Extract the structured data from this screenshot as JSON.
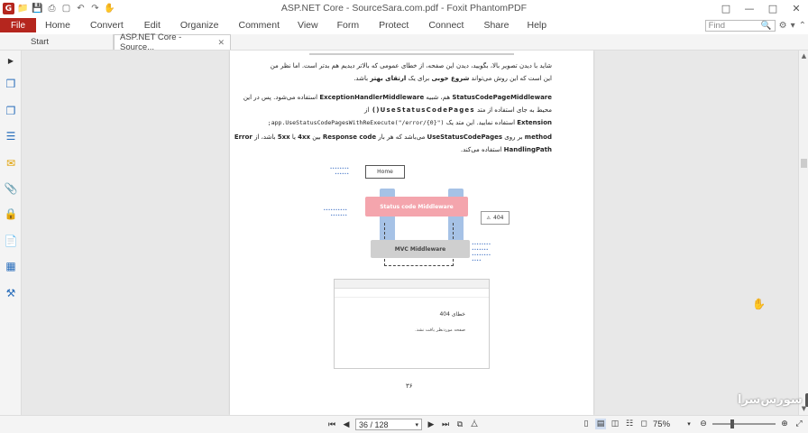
{
  "window": {
    "title": "ASP.NET Core - SourceSara.com.pdf - Foxit PhantomPDF"
  },
  "quick_access": [
    "app-logo-icon",
    "open-icon",
    "save-icon",
    "print-icon",
    "new-icon",
    "undo-icon",
    "redo-icon",
    "hand-tool-icon"
  ],
  "ribbon": {
    "file": "File",
    "tabs": [
      "Home",
      "Convert",
      "Edit",
      "Organize",
      "Comment",
      "View",
      "Form",
      "Protect",
      "Connect",
      "Share",
      "Help"
    ],
    "find_placeholder": "Find"
  },
  "doc_tabs": {
    "start": "Start",
    "active": "ASP.NET Core - Source..."
  },
  "page": {
    "line1": "شاید با دیدن تصویر بالا، بگویید، دیدن این صفحه، از خطای عمومی که بالاتر دیدیم هم بدتر است. اما نظر من",
    "line2a": "این است که این روش می‌تواند ",
    "line2b": "شروع خوبی",
    "line2c": " برای یک ",
    "line2d": "ارتقای بهتر",
    "line2e": " باشد.",
    "p2_l1a": "StatusCodePageMiddleware",
    "p2_l1b": " هم، شبیه ",
    "p2_l1c": "ExceptionHandlerMiddleware",
    "p2_l1d": " استفاده می‌شود. پس در این",
    "p2_l2a": "محیط به جای استفاده از متد ",
    "p2_l2b": "UseStatusCodePages()",
    "p2_l2c": " از",
    "p2_l3a": "Extension",
    "p2_l3b": " استفاده نمایید. این متد یک ",
    "p2_l3c": "app.UseStatusCodePagesWithReExecute(\"/error/{0}\");",
    "p2_l4a": "method",
    "p2_l4b": " بر روی ",
    "p2_l4c": "UseStatusCodePages",
    "p2_l4d": " می‌باشد که هر بار ",
    "p2_l4e": "Response code",
    "p2_l4f": " بین ",
    "p2_l4g": "4xx",
    "p2_l4h": " یا ",
    "p2_l4i": "5xx",
    "p2_l4j": " باشد، از ",
    "p2_l4k": "Error",
    "p2_l5a": "HandlingPath",
    "p2_l5b": " استفاده می‌کند.",
    "diagram": {
      "home": "Home",
      "status": "Status code Middleware",
      "mvc": "MVC Middleware",
      "code404": "404"
    },
    "shot_title": "خطای 404",
    "shot_body": "صفحه موردنظر یافت نشد.",
    "page_number": "۳۶"
  },
  "statusbar": {
    "page_display": "36 / 128",
    "zoom": "75%"
  },
  "watermark": {
    "name": "سورس‌سرا"
  }
}
